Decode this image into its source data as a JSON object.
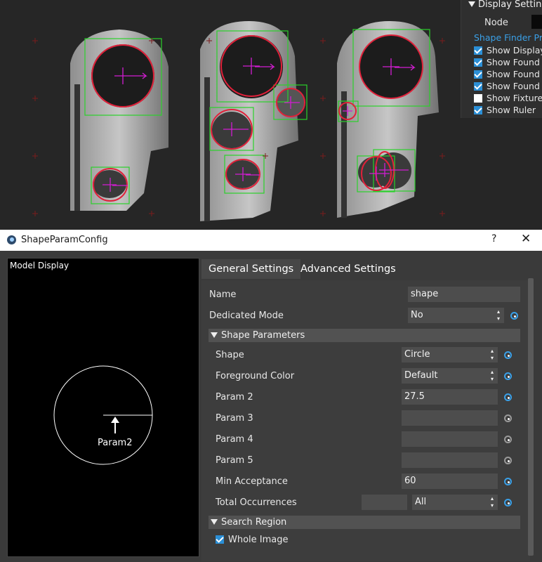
{
  "display_settings": {
    "header": "Display Settings",
    "node_label": "Node",
    "section": "Shape Finder Pr",
    "checks": [
      {
        "label": "Show Display",
        "checked": true
      },
      {
        "label": "Show Found E",
        "checked": true
      },
      {
        "label": "Show Found A",
        "checked": true
      },
      {
        "label": "Show Found E",
        "checked": true
      },
      {
        "label": "Show Fixture",
        "checked": false
      },
      {
        "label": "Show Ruler",
        "checked": true
      }
    ]
  },
  "dialog": {
    "title": "ShapeParamConfig",
    "help": "?",
    "close": "✕"
  },
  "model_display": {
    "label": "Model Display",
    "annotation": "Param2"
  },
  "tabs": {
    "general": "General Settings",
    "advanced": "Advanced Settings"
  },
  "form": {
    "name_label": "Name",
    "name_value": "shape",
    "dedicated_label": "Dedicated Mode",
    "dedicated_value": "No",
    "shape_params_header": "Shape Parameters",
    "shape_label": "Shape",
    "shape_value": "Circle",
    "fg_label": "Foreground Color",
    "fg_value": "Default",
    "param2_label": "Param 2",
    "param2_value": "27.5",
    "param3_label": "Param 3",
    "param3_value": "",
    "param4_label": "Param 4",
    "param4_value": "",
    "param5_label": "Param 5",
    "param5_value": "",
    "minacc_label": "Min Acceptance",
    "minacc_value": "60",
    "total_label": "Total Occurrences",
    "total_value": "",
    "total_select": "All",
    "search_region_header": "Search Region",
    "whole_image_label": "Whole Image",
    "whole_image_checked": true
  },
  "colors": {
    "accent": "#3aa0e8",
    "found_box": "#2bd12b",
    "found_circle": "#e0213a",
    "marker": "#d21cd2"
  }
}
